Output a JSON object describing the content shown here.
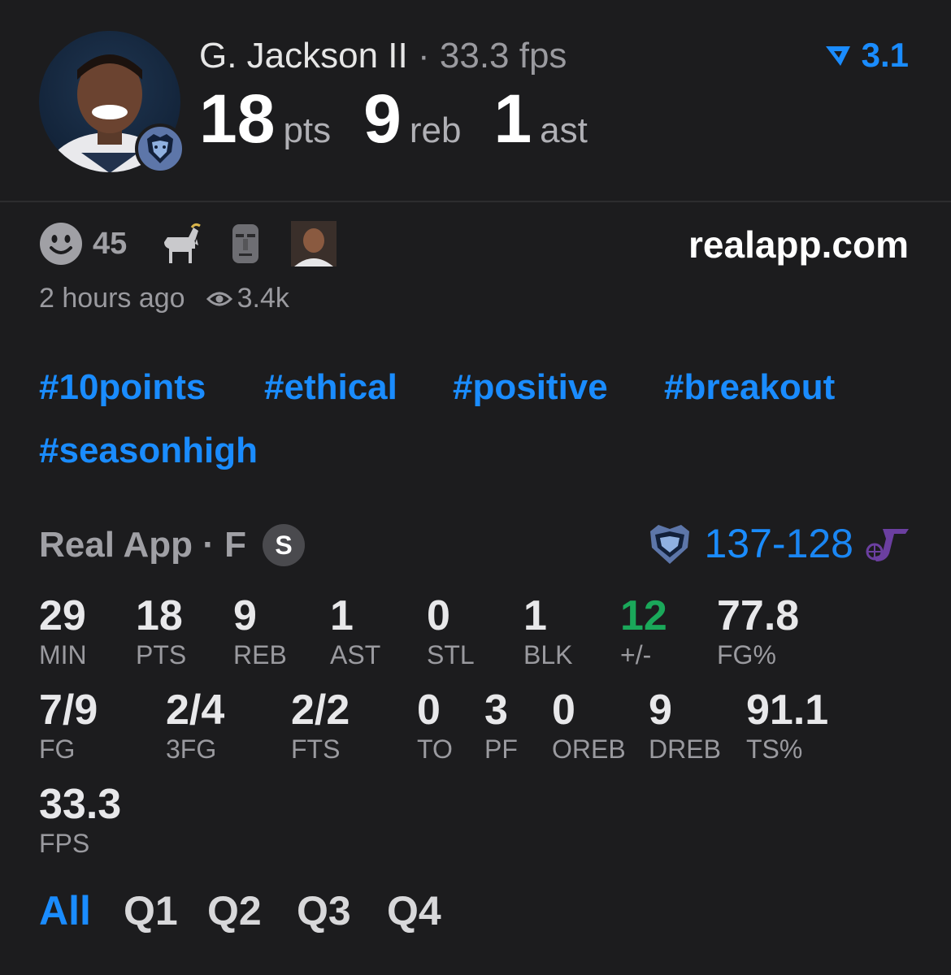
{
  "header": {
    "player_name": "G. Jackson II",
    "separator": " · ",
    "fps_text": "33.3 fps",
    "rating": "3.1",
    "pts_value": "18",
    "pts_unit": "pts",
    "reb_value": "9",
    "reb_unit": "reb",
    "ast_value": "1",
    "ast_unit": "ast"
  },
  "reactions": {
    "smile_count": "45",
    "icons": [
      "smile-icon",
      "goat-icon",
      "moai-icon",
      "person-emoji-icon"
    ]
  },
  "site": "realapp.com",
  "meta": {
    "time_ago": "2 hours ago",
    "views": "3.4k"
  },
  "hashtags": [
    "#10points",
    "#ethical",
    "#positive",
    "#breakout",
    "#seasonhigh"
  ],
  "game": {
    "title": "Real App · F",
    "badge": "S",
    "home_score": "137",
    "score_sep": "-",
    "away_score": "128"
  },
  "stats_row1": [
    {
      "value": "29",
      "label": "MIN"
    },
    {
      "value": "18",
      "label": "PTS"
    },
    {
      "value": "9",
      "label": "REB"
    },
    {
      "value": "1",
      "label": "AST"
    },
    {
      "value": "0",
      "label": "STL"
    },
    {
      "value": "1",
      "label": "BLK"
    },
    {
      "value": "12",
      "label": "+/-"
    },
    {
      "value": "77.8",
      "label": "FG%"
    }
  ],
  "stats_row2": [
    {
      "value": "7/9",
      "label": "FG"
    },
    {
      "value": "2/4",
      "label": "3FG"
    },
    {
      "value": "2/2",
      "label": "FTS"
    },
    {
      "value": "0",
      "label": "TO"
    },
    {
      "value": "3",
      "label": "PF"
    },
    {
      "value": "0",
      "label": "OREB"
    },
    {
      "value": "9",
      "label": "DREB"
    },
    {
      "value": "91.1",
      "label": "TS%"
    }
  ],
  "stats_row3": [
    {
      "value": "33.3",
      "label": "FPS"
    }
  ],
  "tabs": [
    "All",
    "Q1",
    "Q2",
    "Q3",
    "Q4"
  ],
  "colors": {
    "accent": "#1a8cff",
    "positive": "#1aa85a",
    "background": "#1c1c1e"
  }
}
